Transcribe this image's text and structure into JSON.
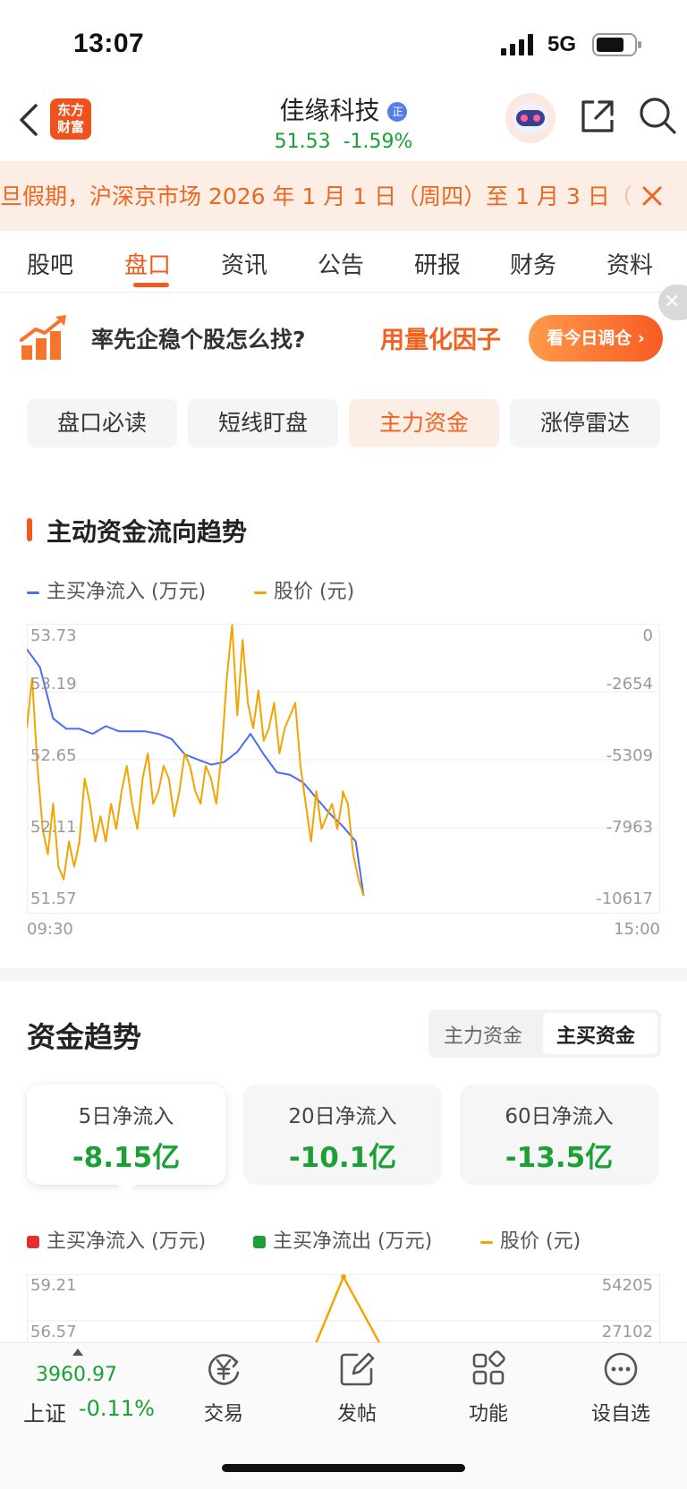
{
  "status": {
    "time": "13:07",
    "network": "5G"
  },
  "header": {
    "stock_name": "佳缘科技",
    "price": "51.53",
    "change_pct": "-1.59%",
    "logo_line1": "东方",
    "logo_line2": "财富",
    "badge": "正"
  },
  "notice": {
    "text": "旦假期，沪深京市场 2026 年 1 月 1 日（周四）至 1 月 3 日（"
  },
  "tabs": [
    "股吧",
    "盘口",
    "资讯",
    "公告",
    "研报",
    "财务",
    "资料"
  ],
  "banner": {
    "question": "率先企稳个股怎么找?",
    "highlight": "用量化因子",
    "button": "看今日调仓 ›"
  },
  "chips": [
    "盘口必读",
    "短线盯盘",
    "主力资金",
    "涨停雷达"
  ],
  "flow_section": {
    "title": "主动资金流向趋势",
    "legend_flow": "主买净流入 (万元)",
    "legend_price": "股价 (元)",
    "time_start": "09:30",
    "time_end": "15:00"
  },
  "colors": {
    "accent": "#f05a1a",
    "flow_line": "#4a6cf7",
    "price_line": "#f5a300",
    "down_green": "#1aa034",
    "up_red": "#e62e2e"
  },
  "chart_data": [
    {
      "type": "line",
      "title": "主动资金流向趋势",
      "x_range": [
        "09:30",
        "15:00"
      ],
      "left_axis_ticks": [
        "53.73",
        "53.19",
        "52.65",
        "52.11",
        "51.57"
      ],
      "right_axis_ticks": [
        "0",
        "-2654",
        "-5309",
        "-7963",
        "-10617"
      ],
      "left_ylim": [
        51.57,
        53.73
      ],
      "right_ylim": [
        -10617,
        0
      ],
      "grid": true,
      "series": [
        {
          "name": "股价 (元)",
          "axis": "left",
          "x": [
            "09:30",
            "09:32",
            "09:34",
            "09:36",
            "09:38",
            "09:40",
            "09:42",
            "09:44",
            "09:46",
            "09:48",
            "09:50",
            "09:52",
            "09:54",
            "09:56",
            "09:58",
            "10:00",
            "10:02",
            "10:04",
            "10:06",
            "10:08",
            "10:10",
            "10:12",
            "10:14",
            "10:16",
            "10:18",
            "10:20",
            "10:22",
            "10:24",
            "10:26",
            "10:28",
            "10:30",
            "10:32",
            "10:34",
            "10:36",
            "10:38",
            "10:40",
            "10:42",
            "10:44",
            "10:46",
            "10:48",
            "10:50",
            "10:52",
            "10:54",
            "10:56",
            "10:58",
            "11:00",
            "11:02",
            "11:04",
            "11:06",
            "11:08",
            "11:10",
            "11:12",
            "11:14",
            "11:16",
            "11:18",
            "11:20",
            "11:22",
            "11:24",
            "11:26",
            "11:28",
            "11:30",
            "13:00",
            "13:02",
            "13:04",
            "13:06",
            "13:08"
          ],
          "values": [
            52.9,
            53.3,
            52.6,
            52.1,
            51.9,
            52.3,
            51.8,
            51.7,
            52.0,
            51.8,
            52.0,
            52.5,
            52.3,
            52.0,
            52.2,
            52.0,
            52.3,
            52.1,
            52.4,
            52.6,
            52.3,
            52.1,
            52.5,
            52.7,
            52.3,
            52.4,
            52.6,
            52.5,
            52.2,
            52.4,
            52.7,
            52.6,
            52.4,
            52.3,
            52.6,
            52.5,
            52.3,
            52.7,
            53.3,
            53.72,
            53.0,
            53.6,
            53.1,
            52.9,
            53.2,
            52.8,
            52.9,
            53.1,
            52.7,
            52.9,
            53.0,
            53.1,
            52.6,
            52.3,
            52.0,
            52.4,
            52.1,
            52.2,
            52.3,
            52.1,
            52.35,
            52.4,
            52.3,
            51.9,
            51.7,
            51.57
          ]
        },
        {
          "name": "主买净流入 (万元)",
          "axis": "right",
          "x": [
            "09:30",
            "09:35",
            "09:40",
            "09:45",
            "09:50",
            "09:55",
            "10:00",
            "10:05",
            "10:10",
            "10:15",
            "10:20",
            "10:25",
            "10:30",
            "10:35",
            "10:40",
            "10:45",
            "10:50",
            "10:55",
            "11:00",
            "11:05",
            "11:10",
            "11:15",
            "11:20",
            "11:25",
            "11:30",
            "13:00",
            "13:05",
            "13:08"
          ],
          "values": [
            -1000,
            -1700,
            -3700,
            -4100,
            -4100,
            -4300,
            -4000,
            -4200,
            -4200,
            -4200,
            -4300,
            -4500,
            -5100,
            -5300,
            -5500,
            -5400,
            -5000,
            -4300,
            -5100,
            -5800,
            -5900,
            -6200,
            -6800,
            -7400,
            -7900,
            -7900,
            -8500,
            -10617
          ]
        }
      ]
    },
    {
      "type": "line",
      "legend": [
        "主买净流入 (万元)",
        "主买净流出 (万元)",
        "股价 (元)"
      ],
      "left_axis_ticks": [
        "59.21",
        "56.57"
      ],
      "right_axis_ticks": [
        "54205",
        "27102"
      ],
      "partial": true
    }
  ],
  "fund_trend": {
    "title": "资金趋势",
    "toggle": [
      "主力资金",
      "主买资金"
    ],
    "toggle_selected": "主买资金",
    "cards": [
      {
        "label": "5日净流入",
        "value": "-8.15亿"
      },
      {
        "label": "20日净流入",
        "value": "-10.1亿"
      },
      {
        "label": "60日净流入",
        "value": "-13.5亿"
      }
    ],
    "legend_in": "主买净流入 (万元)",
    "legend_out": "主买净流出 (万元)",
    "legend_price": "股价 (元)"
  },
  "bottom_nav": {
    "index_value": "3960.97",
    "index_name": "上证",
    "index_change": "-0.11%",
    "items": [
      "交易",
      "发帖",
      "功能",
      "设自选"
    ]
  }
}
